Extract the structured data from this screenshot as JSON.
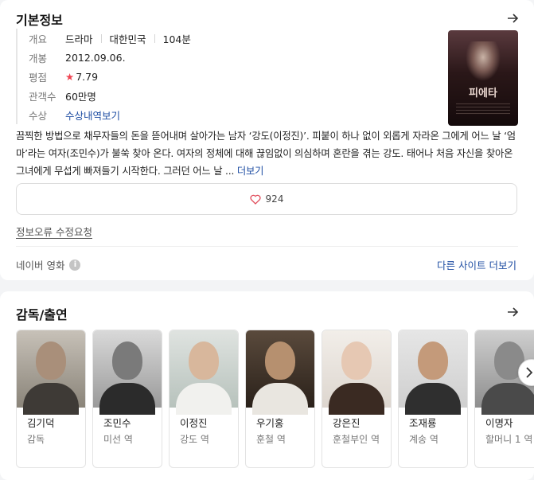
{
  "basic_info": {
    "title": "기본정보",
    "rows": [
      {
        "label": "개요",
        "genre": "드라마",
        "country": "대한민국",
        "runtime": "104분"
      },
      {
        "label": "개봉",
        "value": "2012.09.06."
      },
      {
        "label": "평점",
        "value": "7.79"
      },
      {
        "label": "관객수",
        "value": "60만명"
      },
      {
        "label": "수상",
        "value": "수상내역보기"
      }
    ],
    "poster_title": "피에타",
    "synopsis": "끔찍한 방법으로 채무자들의 돈을 뜯어내며 살아가는 남자 ‘강도(이정진)’. 피붙이 하나 없이 외롭게 자라온 그에게 어느 날 ‘엄마’라는 여자(조민수)가 불쑥 찾아 온다. 여자의 정체에 대해 끊임없이 의심하며 혼란을 겪는 강도. 태어나 처음 자신을 찾아온 그녀에게 무섭게 빠져들기 시작한다. 그러던 어느 날 ...",
    "synopsis_more": "더보기",
    "likes": "924",
    "report_link": "정보오류 수정요청",
    "source": "네이버 영화",
    "info_icon": "i",
    "other_sites": "다른 사이트 더보기"
  },
  "cast": {
    "title": "감독/출연",
    "people": [
      {
        "name": "김기덕",
        "role": "감독"
      },
      {
        "name": "조민수",
        "role": "미선 역"
      },
      {
        "name": "이정진",
        "role": "강도 역"
      },
      {
        "name": "우기홍",
        "role": "훈철 역"
      },
      {
        "name": "강은진",
        "role": "훈철부인 역"
      },
      {
        "name": "조재룡",
        "role": "계송 역"
      },
      {
        "name": "이명자",
        "role": "할머니 1 역"
      }
    ]
  },
  "colors": {
    "accent": "#1f4ea3",
    "star": "#f04452"
  }
}
